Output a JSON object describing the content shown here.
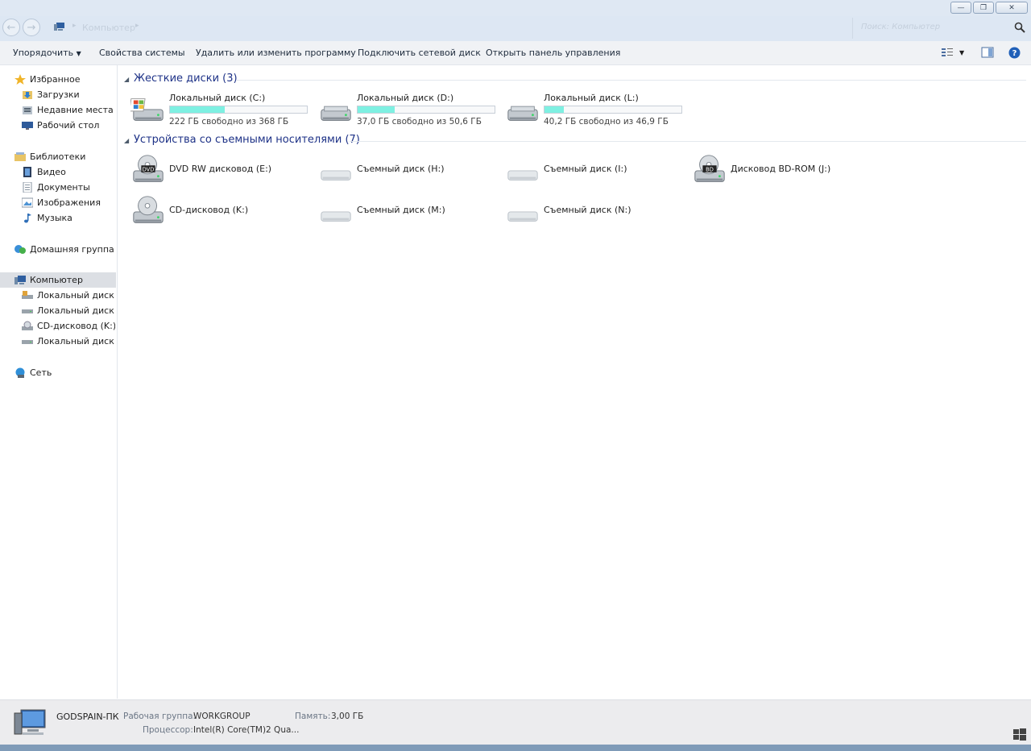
{
  "window": {
    "minimize_glyph": "—",
    "restore_glyph": "❐",
    "close_glyph": "✕"
  },
  "address_bar": {
    "back_glyph": "←",
    "forward_glyph": "→",
    "location_icon": "computer-icon",
    "path": "Компьютер",
    "search_placeholder": "Поиск: Компьютер"
  },
  "toolbar": {
    "organize": "Упорядочить",
    "system_properties": "Свойства системы",
    "uninstall": "Удалить или изменить программу",
    "map_drive": "Подключить сетевой диск",
    "control_panel": "Открыть панель управления"
  },
  "sidebar": {
    "favorites": {
      "label": "Избранное",
      "icon": "star-icon"
    },
    "downloads": {
      "label": "Загрузки",
      "icon": "downloads-folder-icon"
    },
    "recent": {
      "label": "Недавние места",
      "icon": "recent-places-icon"
    },
    "desktop": {
      "label": "Рабочий стол",
      "icon": "desktop-icon"
    },
    "libraries": {
      "label": "Библиотеки",
      "icon": "libraries-icon"
    },
    "video": {
      "label": "Видео",
      "icon": "video-library-icon"
    },
    "documents": {
      "label": "Документы",
      "icon": "documents-library-icon"
    },
    "pictures": {
      "label": "Изображения",
      "icon": "pictures-library-icon"
    },
    "music": {
      "label": "Музыка",
      "icon": "music-library-icon"
    },
    "homegroup": {
      "label": "Домашняя группа",
      "icon": "homegroup-icon"
    },
    "computer": {
      "label": "Компьютер",
      "icon": "computer-icon"
    },
    "disk_c": {
      "label": "Локальный диск (C:)",
      "icon": "system-drive-icon"
    },
    "disk_d": {
      "label": "Локальный диск (D:)",
      "icon": "hard-drive-icon"
    },
    "cd_k": {
      "label": "CD-дисковод (K:)",
      "icon": "cd-drive-icon"
    },
    "disk_l": {
      "label": "Локальный диск (L:)",
      "icon": "hard-drive-icon"
    },
    "network": {
      "label": "Сеть",
      "icon": "network-icon"
    }
  },
  "groups": {
    "hard_disks": "Жесткие диски (3)",
    "removable": "Устройства со съемными носителями (7)"
  },
  "hard_disks": [
    {
      "name": "Локальный диск (C:)",
      "free_text": "222 ГБ свободно из 368 ГБ",
      "used_fraction": 0.4,
      "icon": "system-drive-icon"
    },
    {
      "name": "Локальный диск (D:)",
      "free_text": "37,0 ГБ свободно из 50,6 ГБ",
      "used_fraction": 0.27,
      "icon": "hard-drive-icon"
    },
    {
      "name": "Локальный диск (L:)",
      "free_text": "40,2 ГБ свободно из 46,9 ГБ",
      "used_fraction": 0.14,
      "icon": "hard-drive-icon"
    }
  ],
  "removable": [
    {
      "name": "DVD RW дисковод (E:)",
      "icon": "dvd-drive-icon",
      "badge": "DVD"
    },
    {
      "name": "Съемный диск (H:)",
      "icon": "removable-drive-icon"
    },
    {
      "name": "Съемный диск (I:)",
      "icon": "removable-drive-icon"
    },
    {
      "name": "Дисковод BD-ROM (J:)",
      "icon": "bd-drive-icon",
      "badge": "BD"
    },
    {
      "name": "CD-дисковод (K:)",
      "icon": "cd-drive-icon"
    },
    {
      "name": "Съемный диск (M:)",
      "icon": "removable-drive-icon"
    },
    {
      "name": "Съемный диск (N:)",
      "icon": "removable-drive-icon"
    }
  ],
  "details": {
    "computer_name": "GODSPAIN-ПК",
    "workgroup_label": "Рабочая группа:",
    "workgroup_value": "WORKGROUP",
    "memory_label": "Память:",
    "memory_value": "3,00 ГБ",
    "cpu_label": "Процессор:",
    "cpu_value": "Intel(R) Core(TM)2 Qua..."
  },
  "colors": {
    "usage_fill": "#7ef0e2",
    "group_header": "#1e3287",
    "navbar_bg": "#dde7f3"
  }
}
